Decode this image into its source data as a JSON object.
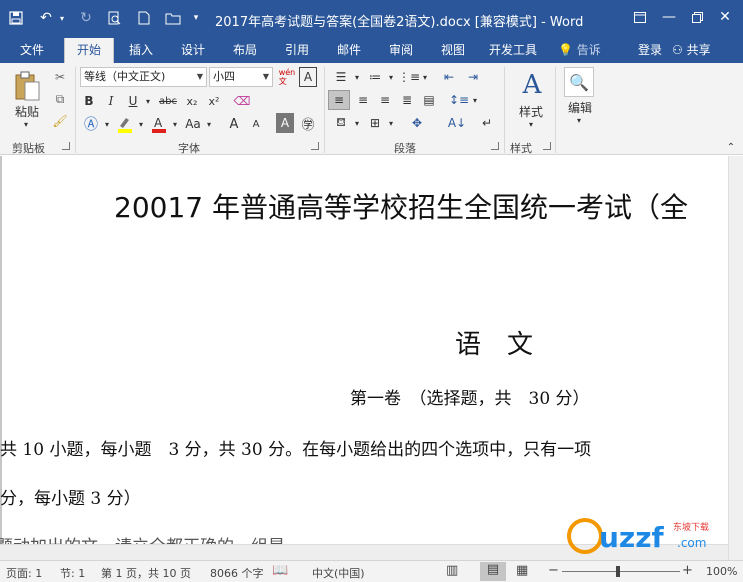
{
  "window": {
    "title": "2017年高考试题与答案(全国卷2语文).docx [兼容模式] - Word"
  },
  "quick_access": {
    "save": "save-icon",
    "undo": "undo-icon",
    "redo": "redo-icon",
    "print_preview": "print-preview-icon",
    "new": "new-document-icon",
    "open": "open-folder-icon"
  },
  "tabs": [
    "文件",
    "开始",
    "插入",
    "设计",
    "布局",
    "引用",
    "邮件",
    "审阅",
    "视图",
    "开发工具"
  ],
  "tell_me": "告诉我...",
  "login": "登录",
  "share": "共享",
  "ribbon": {
    "clipboard": {
      "paste": "粘贴",
      "label": "剪贴板"
    },
    "font": {
      "name": "等线（中文正文)",
      "size": "小四",
      "wen": "wén\n文",
      "bold": "B",
      "italic": "I",
      "underline": "U",
      "strike": "abc",
      "sub": "x₂",
      "sup": "x²",
      "case": "Aa",
      "grow": "A",
      "shrink": "A",
      "label": "字体"
    },
    "paragraph": {
      "label": "段落"
    },
    "styles": {
      "button": "样式",
      "label": "样式"
    },
    "editing": {
      "button": "编辑"
    }
  },
  "document": {
    "title_line": "20017 年普通高等学校招生全国统一考试（全",
    "subject": "语　文",
    "section": "第一卷　（选择题，共　30 分）",
    "line1": "共 10 小题，每小题　3 分，共 30 分。在每小题给出的四个选项中，只有一项",
    "line2": "分，每小题 3 分）",
    "line3": "题动加出的文，请立全都正确的一组是"
  },
  "status": {
    "page": "页面: 1",
    "section": "节: 1",
    "pages": "第 1 页，共 10 页",
    "words": "8066 个字",
    "lang": "中文(中国)",
    "zoom": "100%"
  },
  "watermark": {
    "text": "uzzf",
    "sub": "东坡下载",
    "site": ".com"
  },
  "colors": {
    "accent": "#2b579a",
    "ribbon_bg": "#f3f3f3"
  }
}
